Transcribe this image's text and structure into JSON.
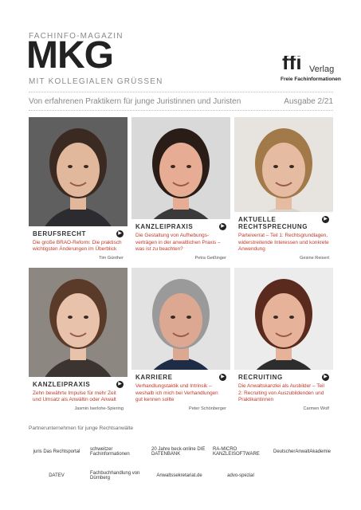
{
  "header": {
    "kicker": "FACHINFO-MAGAZIN",
    "masthead": "MKG",
    "tagline": "MIT KOLLEGIALEN GRÜSSEN",
    "publisher_logo_text": "ffi",
    "publisher_verlag": "Verlag",
    "publisher_sub": "Freie Fachinformationen"
  },
  "subtitle": "Von erfahrenen Praktikern für junge Juristinnen und Juristen",
  "issue": "Ausgabe 2/21",
  "cards": [
    {
      "title": "BERUFSRECHT",
      "text": "Die große BRAO-Reform: Die praktisch wichtigsten Änderungen im Überblick",
      "author": "Tim Günther",
      "bg": "#5f5f5f",
      "hair": "#3b2a22",
      "skin": "#e2b89d",
      "shirt": "#2c2c30"
    },
    {
      "title": "KANZLEIPRAXIS",
      "text": "Die Gestaltung von Aufhebungs-verträgen in der anwaltlichen Praxis – was ist zu beachten?",
      "author": "Petra Geißinger",
      "bg": "#d9d9d9",
      "hair": "#2a1d18",
      "skin": "#e6ad94",
      "shirt": "#3a3a3a"
    },
    {
      "title": "AKTUELLE RECHTSPRECHUNG",
      "text": "Parteiverrat – Teil 1: Rechtsgrundlagen, widerstreitende Interessen und konkrete Anwendung",
      "author": "Gesine Reisert",
      "bg": "#e7e3df",
      "hair": "#a27a4a",
      "skin": "#e5bca2",
      "shirt": "#d9d3cb"
    },
    {
      "title": "KANZLEIPRAXIS",
      "text": "Zehn bewährte Impulse für mehr Zeit und Umsatz als Anwältin oder Anwalt",
      "author": "Jasmin Iserlohe-Spiering",
      "bg": "#8c8780",
      "hair": "#5a3a28",
      "skin": "#e9c2ab",
      "shirt": "#3b3430"
    },
    {
      "title": "KARRIERE",
      "text": "Verhandlungstaktik und Intrinsik – weshalb ich mich bei Verhandlungen gut kennen sollte",
      "author": "Peter Schönberger",
      "bg": "#e2e2e2",
      "hair": "#9a9a9a",
      "skin": "#dca892",
      "shirt": "#1e2c45"
    },
    {
      "title": "RECRUITING",
      "text": "Die Anwaltskanzlei als Ausbilder – Teil 2: Recruiting von Auszubildenden und Praktikantinnen",
      "author": "Carmen Wolf",
      "bg": "#ececec",
      "hair": "#5a2a1e",
      "skin": "#e6b39a",
      "shirt": "#2d2d2d"
    }
  ],
  "partners": {
    "label": "Partnerunternehmen für junge Rechtsanwälte",
    "logos": [
      {
        "name": "juris",
        "sub": "Das Rechtsportal"
      },
      {
        "name": "schweitzer",
        "sub": "Fachinformationen"
      },
      {
        "name": "20 Jahre beck-online",
        "sub": "DIE DATENBANK"
      },
      {
        "name": "RA-MICRO",
        "sub": "KANZLEISOFTWARE"
      },
      {
        "name": "DeutscherAnwaltAkademie",
        "sub": ""
      },
      {
        "name": "DATEV",
        "sub": ""
      },
      {
        "name": "Fachbuchhandlung von Dürnberg",
        "sub": ""
      },
      {
        "name": "Anwaltssekretariat.de",
        "sub": ""
      },
      {
        "name": "advo-spezial",
        "sub": ""
      }
    ]
  },
  "colors": {
    "accent": "#c0392b",
    "text": "#333333",
    "muted": "#888888"
  }
}
